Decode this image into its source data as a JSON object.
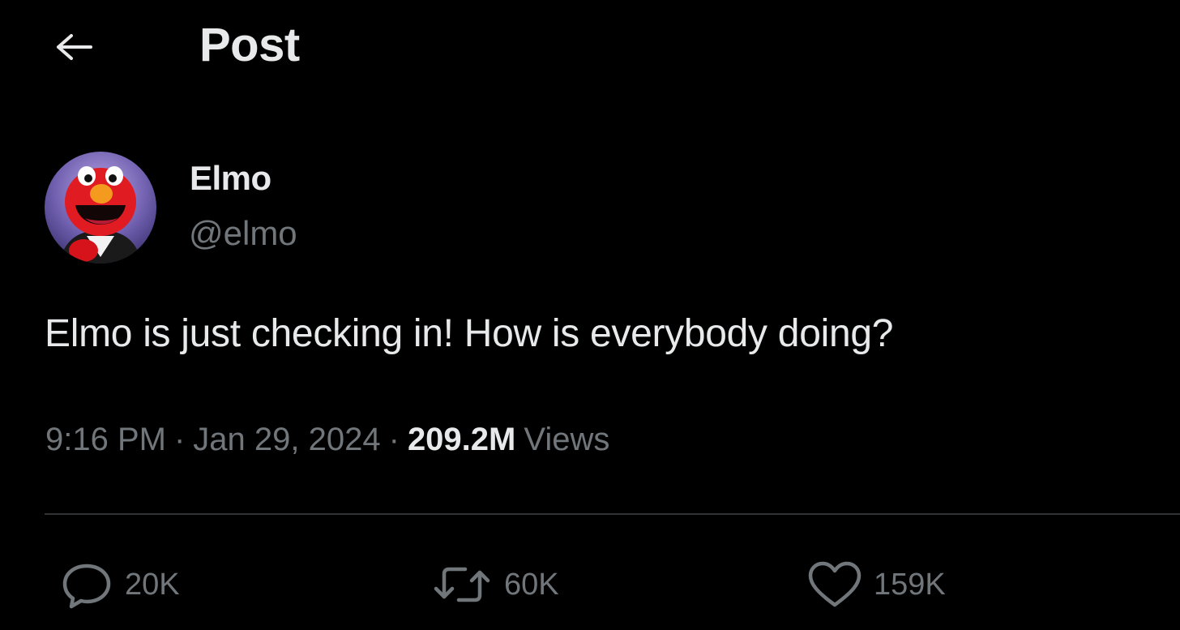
{
  "header": {
    "title": "Post",
    "back_icon": "arrow-left-icon"
  },
  "author": {
    "display_name": "Elmo",
    "handle": "@elmo",
    "avatar_icon": "elmo-avatar"
  },
  "post": {
    "text": "Elmo is just checking in! How is everybody doing?",
    "time": "9:16 PM",
    "separator": "·",
    "date": "Jan 29, 2024",
    "views_count": "209.2M",
    "views_label": "Views"
  },
  "actions": {
    "reply": {
      "icon": "reply-bubble-icon",
      "count": "20K"
    },
    "repost": {
      "icon": "repost-icon",
      "count": "60K"
    },
    "like": {
      "icon": "heart-icon",
      "count": "159K"
    }
  },
  "colors": {
    "background": "#000000",
    "primary_text": "#e7e9ea",
    "secondary_text": "#71767b",
    "divider": "#2f3336"
  }
}
